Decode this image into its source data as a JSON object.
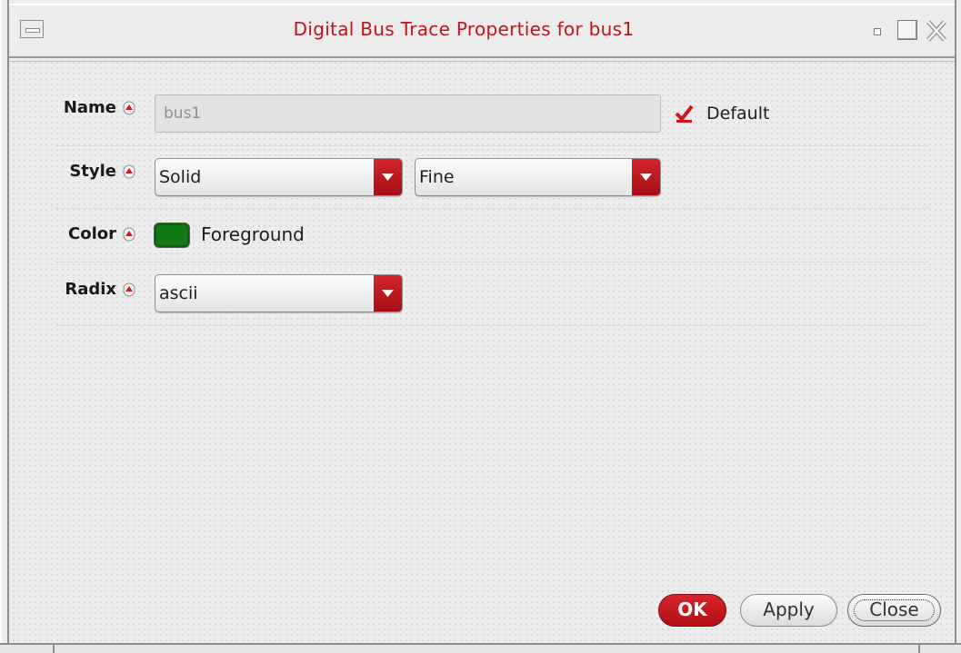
{
  "window": {
    "title": "Digital Bus Trace Properties for bus1",
    "title_color": "#c0141c",
    "controls": [
      "window-menu-icon",
      "minimize-icon",
      "maximize-icon",
      "close-icon"
    ]
  },
  "form": {
    "name": {
      "label": "Name",
      "value": "bus1",
      "enabled": false,
      "default_checkbox": {
        "label": "Default",
        "checked": true
      }
    },
    "style": {
      "label": "Style",
      "line_style": "Solid",
      "thickness": "Fine"
    },
    "color": {
      "label": "Color",
      "swatch": "#117a14",
      "value": "Foreground"
    },
    "radix": {
      "label": "Radix",
      "value": "ascii"
    }
  },
  "buttons": {
    "ok": "OK",
    "apply": "Apply",
    "close": "Close"
  },
  "colors": {
    "accent_red": "#c8151d",
    "background": "#ececec"
  }
}
